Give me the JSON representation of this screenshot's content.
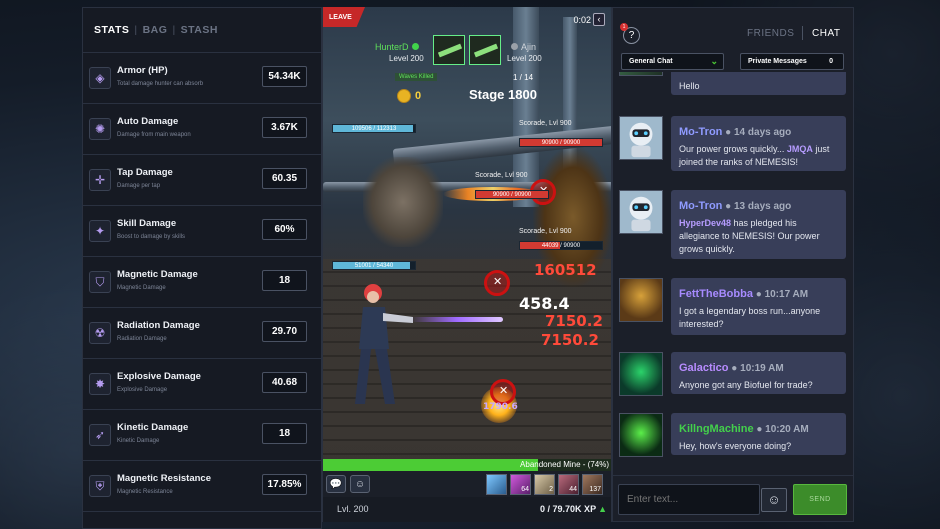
{
  "stats_panel": {
    "tabs": [
      "STATS",
      "BAG",
      "STASH"
    ],
    "rows": [
      {
        "name": "Armor (HP)",
        "desc": "Total damage hunter can absorb",
        "value": "54.34K",
        "icon": "armor-icon"
      },
      {
        "name": "Auto Damage",
        "desc": "Damage from main weapon",
        "value": "3.67K",
        "icon": "auto-damage-icon"
      },
      {
        "name": "Tap Damage",
        "desc": "Damage per tap",
        "value": "60.35",
        "icon": "tap-damage-icon"
      },
      {
        "name": "Skill Damage",
        "desc": "Boost to damage by skills",
        "value": "60%",
        "icon": "skill-damage-icon"
      },
      {
        "name": "Magnetic Damage",
        "desc": "Magnetic Damage",
        "value": "18",
        "icon": "magnetic-damage-icon"
      },
      {
        "name": "Radiation Damage",
        "desc": "Radiation Damage",
        "value": "29.70",
        "icon": "radiation-damage-icon"
      },
      {
        "name": "Explosive Damage",
        "desc": "Explosive Damage",
        "value": "40.68",
        "icon": "explosive-damage-icon"
      },
      {
        "name": "Kinetic Damage",
        "desc": "Kinetic Damage",
        "value": "18",
        "icon": "kinetic-damage-icon"
      },
      {
        "name": "Magnetic Resistance",
        "desc": "Magnetic Resistance",
        "value": "17.85%",
        "icon": "magnetic-resistance-icon"
      }
    ]
  },
  "game": {
    "leave_label": "LEAVE",
    "timer": "0:02",
    "player": {
      "name": "HunterD",
      "level": "Level 200"
    },
    "ally": {
      "name": "Ajin",
      "level": "Level 200"
    },
    "wave_label": "Waves Killed",
    "wave_count": "1 / 14",
    "coins": "0",
    "stage": "Stage 1800",
    "hp_bars": [
      {
        "text": "109506 / 112313",
        "fraction": 0.975,
        "color": "#5fb7d8"
      },
      {
        "text": "90900 / 90900",
        "fraction": 1.0,
        "color": "#d23a32"
      },
      {
        "text": "90900 / 90900",
        "fraction": 1.0,
        "color": "#d23a32"
      },
      {
        "text": "44039 / 90900",
        "fraction": 0.484,
        "color": "#d23a32"
      },
      {
        "text": "51001 / 54340",
        "fraction": 0.938,
        "color": "#5fb7d8"
      }
    ],
    "enemy_names": [
      "Scorade, Lvl 900",
      "Scorade, Lvl 900",
      "Scorade, Lvl 900"
    ],
    "damage_numbers": [
      "160512",
      "458.4",
      "7150.2",
      "7150.2",
      "1790.6"
    ],
    "location": {
      "label": "Abandoned Mine - (74%)",
      "progress": 0.74
    },
    "skills": [
      "64",
      "2",
      "44",
      "137"
    ],
    "level": "Lvl. 200",
    "xp": "0 / 79.70K XP"
  },
  "chat": {
    "notification_count": "1",
    "help": "?",
    "tabs": [
      "FRIENDS",
      "CHAT"
    ],
    "channel": "General Chat",
    "private_label": "Private Messages",
    "private_count": "0",
    "messages": [
      {
        "user": "",
        "time": "",
        "text": "Hello",
        "user_color": "#9fa8ff"
      },
      {
        "user": "Mo-Tron",
        "time": "14 days ago",
        "mention": "JMQA",
        "text_before": "Our power grows quickly... ",
        "text_after": " just joined the ranks of NEMESIS!",
        "user_color": "#8f9bff"
      },
      {
        "user": "Mo-Tron",
        "time": "13 days ago",
        "mention": "HyperDev48",
        "text_before": "",
        "text_after": " has pledged his allegiance to NEMESIS! Our power grows quickly.",
        "user_color": "#8f9bff"
      },
      {
        "user": "FettTheBobba",
        "time": "10:17 AM",
        "text": "I got a legendary boss run...anyone interested?",
        "user_color": "#a78bff"
      },
      {
        "user": "Galactico",
        "time": "10:19 AM",
        "text": "Anyone got any Biofuel for trade?",
        "user_color": "#b88cff"
      },
      {
        "user": "KillngMachine",
        "time": "10:20 AM",
        "text": "Hey, how's everyone doing?",
        "user_color": "#43d04b"
      }
    ],
    "input_placeholder": "Enter text...",
    "send_label": "SEND"
  }
}
